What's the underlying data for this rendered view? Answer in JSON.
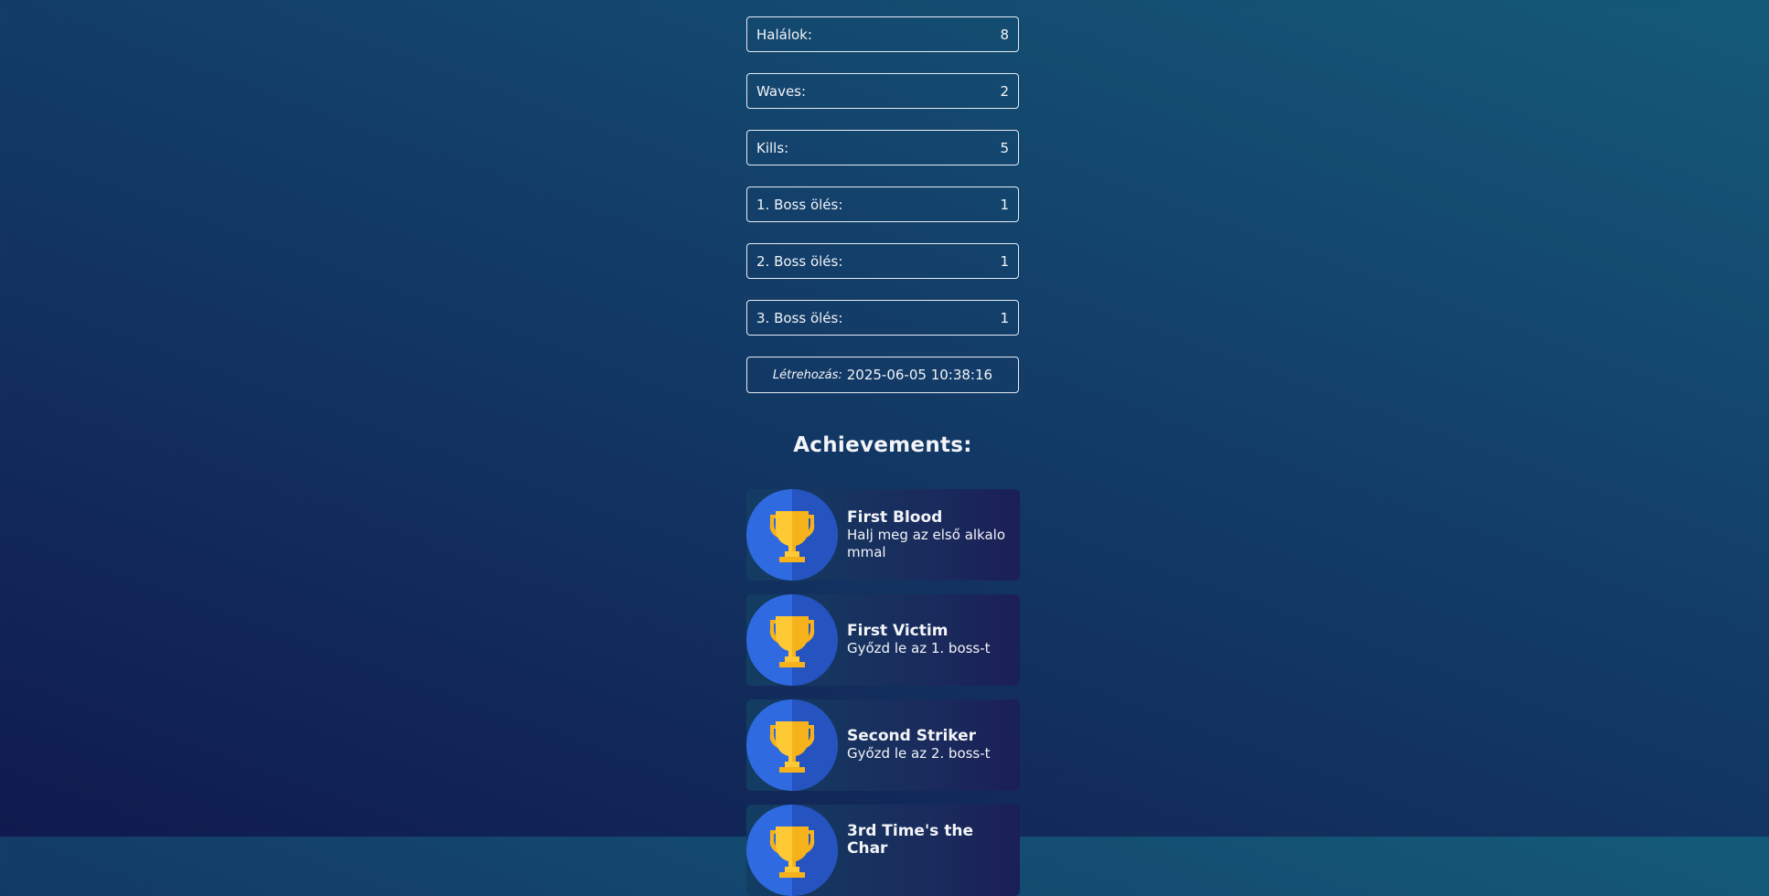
{
  "stats": [
    {
      "label": "Halálok:",
      "value": "8"
    },
    {
      "label": "Waves:",
      "value": "2"
    },
    {
      "label": "Kills:",
      "value": "5"
    },
    {
      "label": "1. Boss ölés:",
      "value": "1"
    },
    {
      "label": "2. Boss ölés:",
      "value": "1"
    },
    {
      "label": "3. Boss ölés:",
      "value": "1"
    }
  ],
  "created": {
    "label": "Létrehozás:",
    "value": "2025-06-05 10:38:16"
  },
  "achievements_title": "Achievements:",
  "achievements": [
    {
      "name": "First Blood",
      "desc": "Halj meg az első alkalommal",
      "icon": "trophy-icon"
    },
    {
      "name": "First Victim",
      "desc": "Győzd le az 1. boss-t",
      "icon": "trophy-icon"
    },
    {
      "name": "Second Striker",
      "desc": "Győzd le az 2. boss-t",
      "icon": "trophy-icon"
    },
    {
      "name": "3rd Time's the Char",
      "desc": "",
      "icon": "trophy-icon"
    }
  ],
  "colors": {
    "trophy_gold": "#f6b21a",
    "trophy_light": "#ffc935",
    "circle": "#2f6ae0"
  }
}
